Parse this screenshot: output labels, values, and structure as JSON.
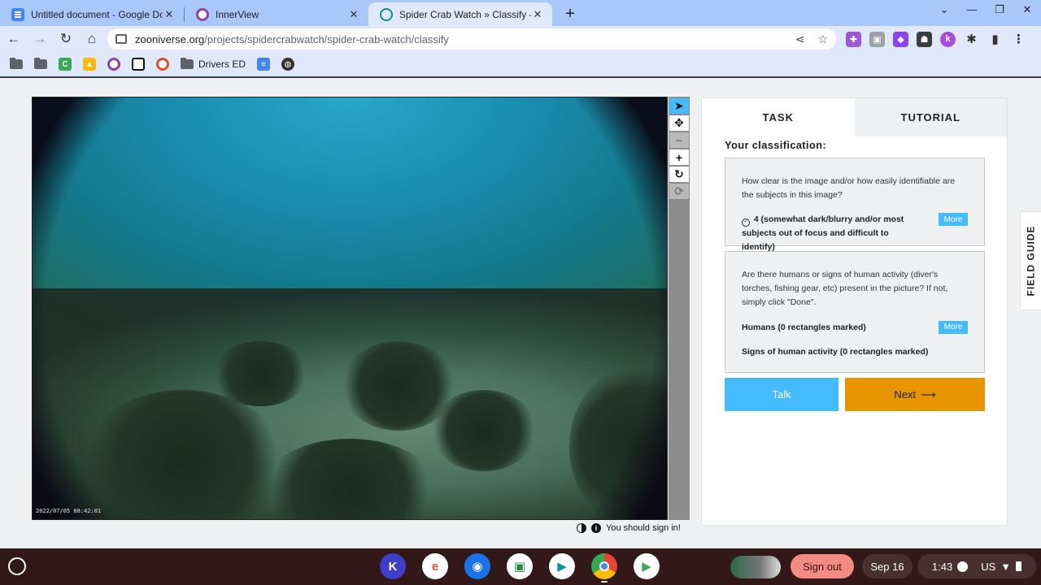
{
  "browser": {
    "tabs": [
      {
        "title": "Untitled document - Google Docs",
        "icon": "google-docs-icon",
        "active": false
      },
      {
        "title": "InnerView",
        "icon": "innerview-icon",
        "active": false
      },
      {
        "title": "Spider Crab Watch » Classify — Zooniverse",
        "icon": "zooniverse-icon",
        "active": true
      }
    ],
    "new_tab": "+",
    "url_host": "zooniverse.org",
    "url_path": "/projects/spidercrabwatch/spider-crab-watch/classify",
    "bookmarks": [
      {
        "label": "",
        "icon": "folder-icon"
      },
      {
        "label": "",
        "icon": "folder-icon"
      },
      {
        "label": "",
        "icon": "classroom-c-icon"
      },
      {
        "label": "",
        "icon": "classroom-icon"
      },
      {
        "label": "",
        "icon": "innerview-icon"
      },
      {
        "label": "",
        "icon": "qr-code-icon"
      },
      {
        "label": "",
        "icon": "edpuzzle-icon"
      },
      {
        "label": "Drivers ED",
        "icon": "folder-icon"
      },
      {
        "label": "",
        "icon": "docs-icon"
      },
      {
        "label": "",
        "icon": "globe-icon"
      }
    ]
  },
  "subject": {
    "timestamp": "2022/07/05 08:42:01"
  },
  "footer": {
    "sign_in_notice": "You should sign in!"
  },
  "task_panel": {
    "tab_task": "TASK",
    "tab_tutorial": "TUTORIAL",
    "classification_title": "Your classification:",
    "question1": "How clear is the image and/or how easily identifiable are the subjects in this image?",
    "answer1": "4 (somewhat dark/blurry and/or most subjects out of focus and difficult to identify)",
    "more_label": "More",
    "question2": "Are there humans or signs of human activity (diver's torches, fishing gear, etc) present in the picture? If not, simply click \"Done\".",
    "tool1": "Humans (0 rectangles marked)",
    "tool2": "Signs of human activity (0 rectangles marked)",
    "talk_label": "Talk",
    "next_label": "Next",
    "field_guide": "FIELD GUIDE"
  },
  "shelf": {
    "sign_out": "Sign out",
    "date": "Sep 16",
    "time": "1:43",
    "locale": "US"
  },
  "colors": {
    "accent_blue": "#43bbfd",
    "next_orange": "#e69400",
    "sign_out_red": "#f28b82"
  }
}
